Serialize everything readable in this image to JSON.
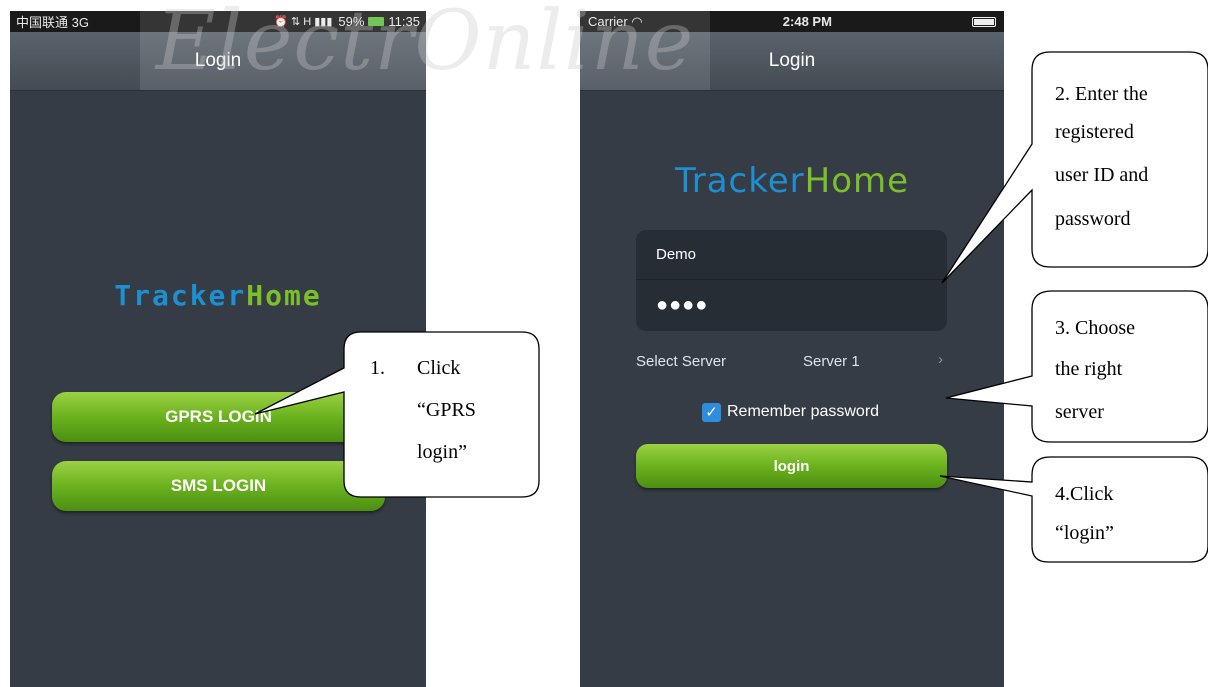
{
  "watermark": "ElectrOnline",
  "android_screen": {
    "status_left": "中国联通 3G",
    "status_icons": "⏰ ⇅ H ▮▮▮",
    "battery": "59%",
    "time": "11:35",
    "title": "Login",
    "logo_part1": "Tracker",
    "logo_part2": "Home",
    "gprs_button": "GPRS LOGIN",
    "sms_button": "SMS LOGIN"
  },
  "ios_screen": {
    "carrier": "Carrier",
    "time": "2:48 PM",
    "title": "Login",
    "logo_part1": "Tracker",
    "logo_part2": "Home",
    "user_id": "Demo",
    "password_mask": "●●●●",
    "server_label": "Select Server",
    "server_value": "Server 1",
    "chevron": "›",
    "remember_label": "Remember password",
    "check_mark": "✓",
    "login_button": "login"
  },
  "callouts": {
    "c1_number": "1.",
    "c1_line1": "Click",
    "c1_line2": "“GPRS",
    "c1_line3": "login”",
    "c2_line1": "2. Enter the",
    "c2_line2": "registered",
    "c2_line3": "user ID and",
    "c2_line4": "password",
    "c3_line1": "3. Choose",
    "c3_line2": "the right",
    "c3_line3": "server",
    "c4_line1": "4.Click",
    "c4_line2": "“login”"
  },
  "colors": {
    "screen_bg": "#353c45",
    "logo_blue": "#1e8fd0",
    "logo_green": "#7bbf2b",
    "button_green": "#6bb21e",
    "checkbox_blue": "#2f8de0"
  }
}
